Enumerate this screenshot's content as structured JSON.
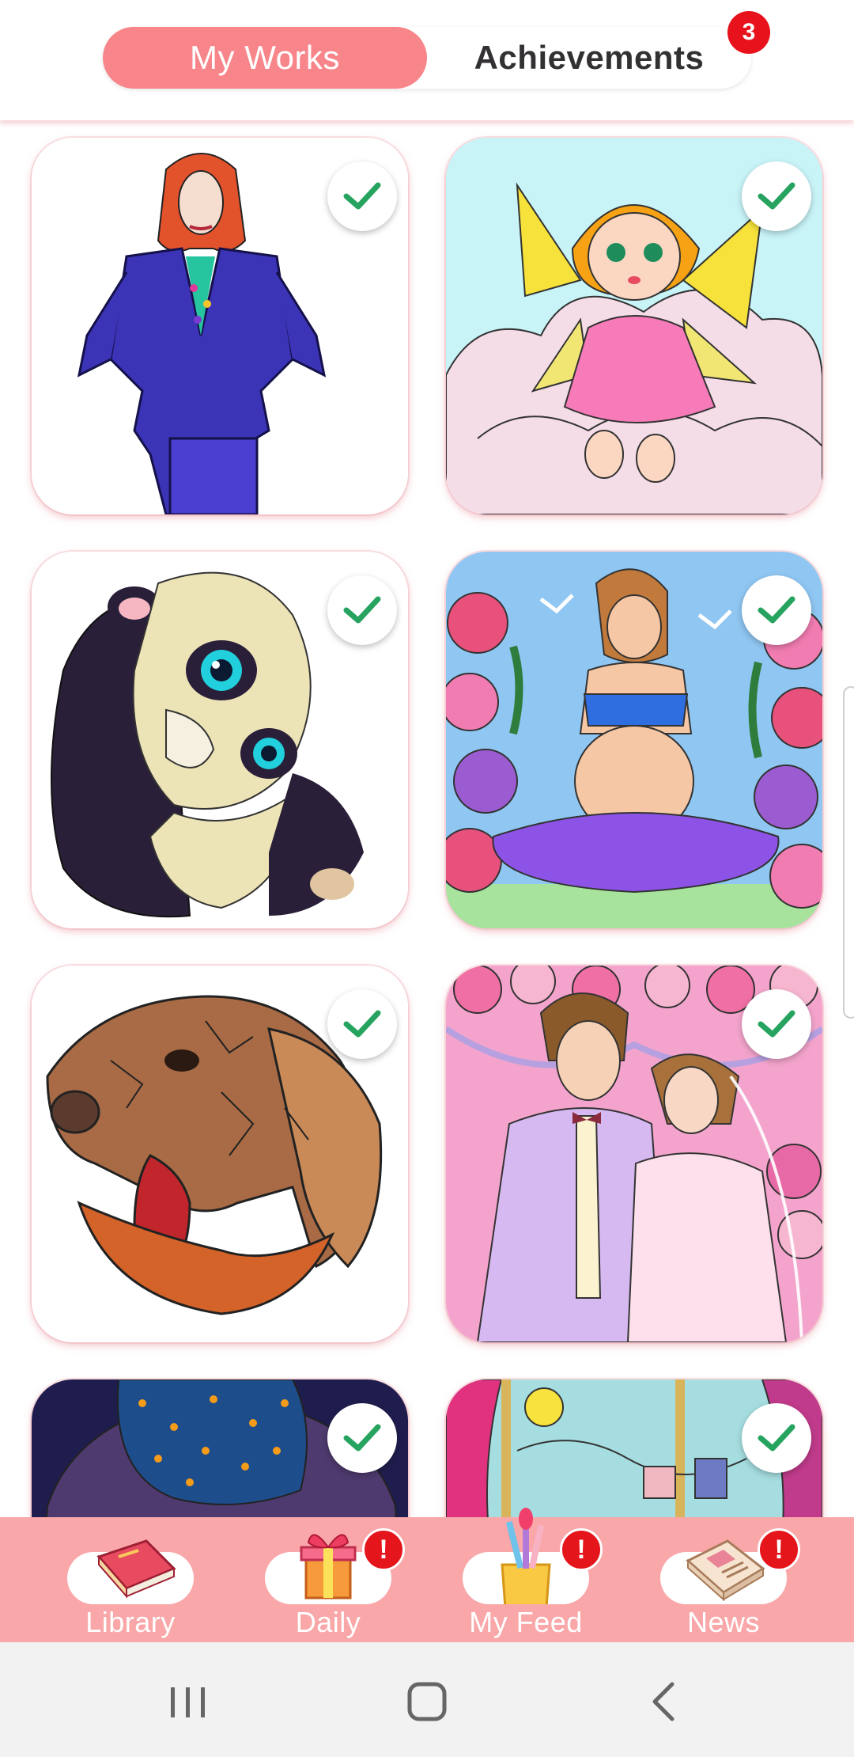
{
  "header": {
    "tabs": [
      {
        "label": "My Works",
        "active": true
      },
      {
        "label": "Achievements",
        "active": false
      }
    ],
    "achievements_badge": "3"
  },
  "colors": {
    "accent": "#f7858a",
    "nav_background": "#f9a7a9",
    "check_green": "#27a360",
    "alert_red": "#e4151b"
  },
  "gallery": {
    "items": [
      {
        "subject": "woman in purple suit",
        "completed": true
      },
      {
        "subject": "fairy on cloud",
        "completed": true
      },
      {
        "subject": "panda cub",
        "completed": true
      },
      {
        "subject": "pregnant woman with flowers",
        "completed": true
      },
      {
        "subject": "dog mandala",
        "completed": true
      },
      {
        "subject": "wedding couple",
        "completed": true
      },
      {
        "subject": "starry night",
        "completed": true
      },
      {
        "subject": "window with sun",
        "completed": true
      }
    ]
  },
  "bottom_nav": {
    "items": [
      {
        "label": "Library",
        "icon": "book-icon",
        "alert": ""
      },
      {
        "label": "Daily",
        "icon": "gift-icon",
        "alert": "!"
      },
      {
        "label": "My Feed",
        "icon": "brush-cup-icon",
        "alert": "!"
      },
      {
        "label": "News",
        "icon": "newspaper-icon",
        "alert": "!"
      }
    ]
  },
  "system_nav": {
    "buttons": [
      "recent-apps-icon",
      "home-icon",
      "back-icon"
    ]
  }
}
